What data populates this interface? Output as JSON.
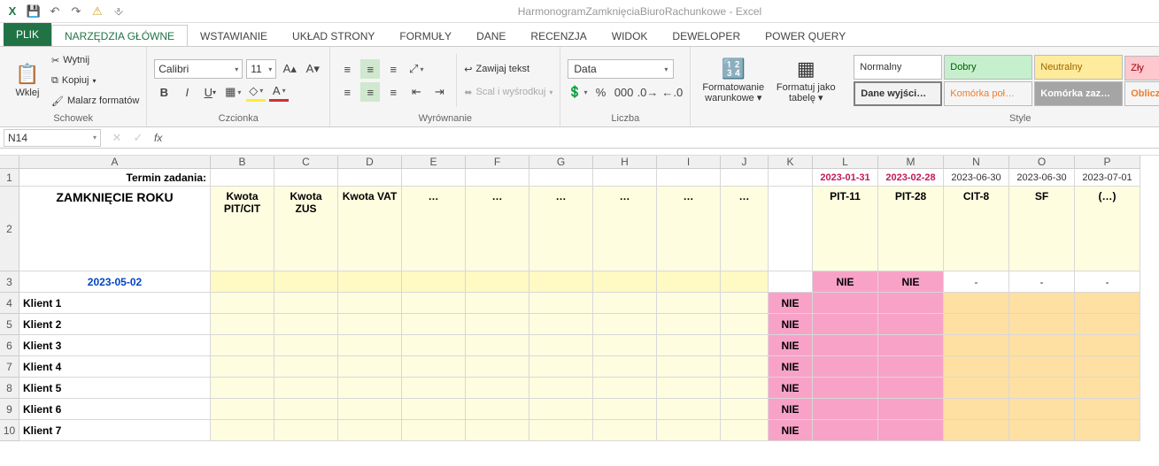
{
  "title": "HarmonogramZamknięciaBiuroRachunkowe - Excel",
  "tabs": {
    "file": "PLIK",
    "home": "NARZĘDZIA GŁÓWNE",
    "insert": "WSTAWIANIE",
    "layout": "UKŁAD STRONY",
    "formulas": "FORMUŁY",
    "data": "DANE",
    "review": "RECENZJA",
    "view": "WIDOK",
    "developer": "DEWELOPER",
    "pq": "POWER QUERY"
  },
  "ribbon": {
    "clipboard": {
      "paste": "Wklej",
      "cut": "Wytnij",
      "copy": "Kopiuj",
      "painter": "Malarz formatów",
      "label": "Schowek"
    },
    "font": {
      "name": "Calibri",
      "size": "11",
      "label": "Czcionka"
    },
    "align": {
      "wrap": "Zawijaj tekst",
      "merge": "Scal i wyśrodkuj",
      "label": "Wyrównanie"
    },
    "number": {
      "format": "Data",
      "label": "Liczba"
    },
    "stylesgrp": {
      "cond": "Formatowanie warunkowe",
      "table": "Formatuj jako tabelę",
      "label": "Style"
    },
    "styles": {
      "normal": "Normalny",
      "good": "Dobry",
      "neutral": "Neutralny",
      "bad": "Zły",
      "output": "Dane wyjści…",
      "linked": "Komórka poł…",
      "check": "Komórka zaz…",
      "calc": "Oblicz"
    }
  },
  "namebox": "N14",
  "columns": [
    "A",
    "B",
    "C",
    "D",
    "E",
    "F",
    "G",
    "H",
    "I",
    "J",
    "K",
    "L",
    "M",
    "N",
    "O",
    "P"
  ],
  "row1": {
    "A": "Termin zadania:",
    "L": "2023-01-31",
    "M": "2023-02-28",
    "N": "2023-06-30",
    "O": "2023-06-30",
    "P": "2023-07-01"
  },
  "row2": {
    "A": "ZAMKNIĘCIE ROKU",
    "B": "Kwota PIT/CIT",
    "C": "Kwota ZUS",
    "D": "Kwota VAT",
    "E": "…",
    "F": "…",
    "G": "…",
    "H": "…",
    "I": "…",
    "J": "…",
    "L": "PIT-11",
    "M": "PIT-28",
    "N": "CIT-8",
    "O": "SF",
    "P": "(…)"
  },
  "row3": {
    "A": "2023-05-02",
    "L": "NIE",
    "M": "NIE",
    "N": "-",
    "O": "-",
    "P": "-"
  },
  "clients": [
    "Klient 1",
    "Klient 2",
    "Klient 3",
    "Klient 4",
    "Klient 5",
    "Klient 6",
    "Klient 7"
  ],
  "nie": "NIE",
  "chart_data": {
    "type": "table",
    "title": "HarmonogramZamknięciaBiuroRachunkowe",
    "deadlines": {
      "PIT-11": "2023-01-31",
      "PIT-28": "2023-02-28",
      "CIT-8": "2023-06-30",
      "SF": "2023-06-30",
      "(…)": "2023-07-01"
    },
    "amount_columns": [
      "Kwota PIT/CIT",
      "Kwota ZUS",
      "Kwota VAT"
    ],
    "summary_date": "2023-05-02",
    "summary_status": {
      "PIT-11": "NIE",
      "PIT-28": "NIE",
      "CIT-8": "-",
      "SF": "-",
      "(…)": "-"
    },
    "clients": [
      {
        "name": "Klient 1",
        "K": "NIE"
      },
      {
        "name": "Klient 2",
        "K": "NIE"
      },
      {
        "name": "Klient 3",
        "K": "NIE"
      },
      {
        "name": "Klient 4",
        "K": "NIE"
      },
      {
        "name": "Klient 5",
        "K": "NIE"
      },
      {
        "name": "Klient 6",
        "K": "NIE"
      },
      {
        "name": "Klient 7",
        "K": "NIE"
      }
    ]
  }
}
